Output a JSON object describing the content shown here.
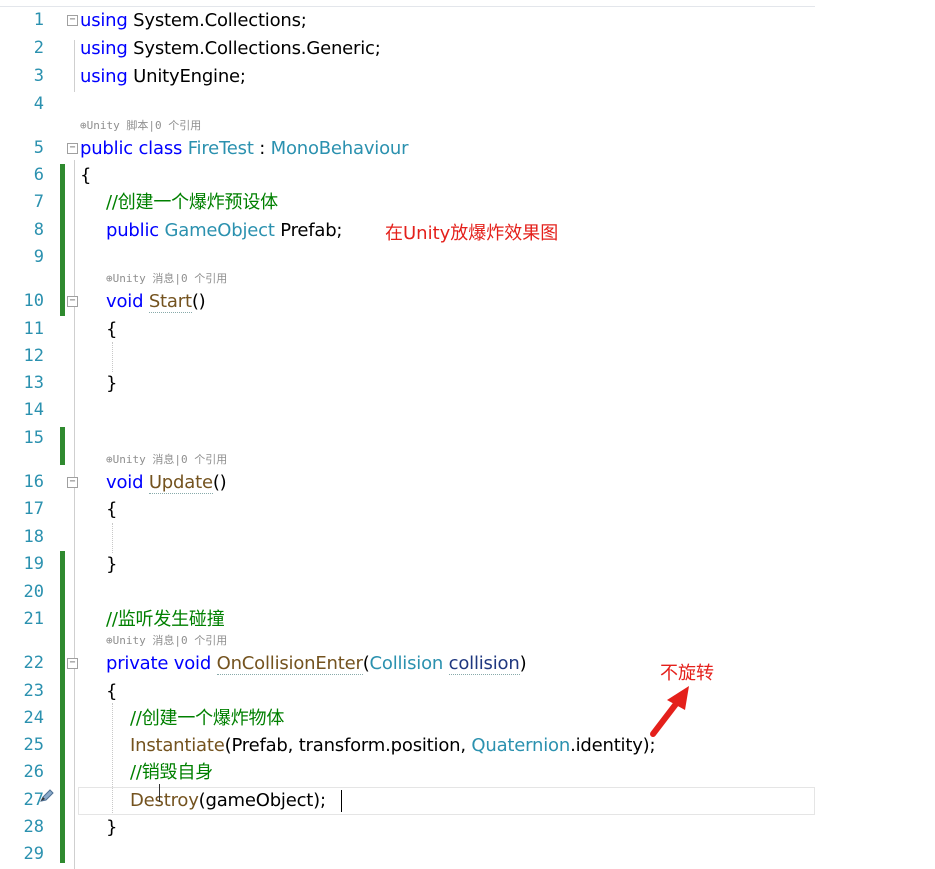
{
  "line_numbers": [
    "1",
    "2",
    "3",
    "4",
    "5",
    "6",
    "7",
    "8",
    "9",
    "10",
    "11",
    "12",
    "13",
    "14",
    "15",
    "16",
    "17",
    "18",
    "19",
    "20",
    "21",
    "22",
    "23",
    "24",
    "25",
    "26",
    "27",
    "28",
    "29"
  ],
  "codelens": {
    "class": "⊕Unity 脚本|0 个引用",
    "start": "⊕Unity 消息|0 个引用",
    "update": "⊕Unity 消息|0 个引用",
    "collision": "⊕Unity 消息|0 个引用"
  },
  "code": {
    "l1_using": "using",
    "l1_ns": " System.Collections;",
    "l2_using": "using",
    "l2_ns": " System.Collections.Generic;",
    "l3_using": "using",
    "l3_ns": " UnityEngine;",
    "l5_public": "public",
    "l5_class": " class ",
    "l5_name": "FireTest",
    "l5_colon": " : ",
    "l5_base": "MonoBehaviour",
    "l6": "{",
    "l7_comment": "//创建一个爆炸预设体",
    "l8_public": "public",
    "l8_type": " GameObject",
    "l8_field": " Prefab;",
    "l10_void": "void",
    "l10_name": "Start",
    "l10_parens": "()",
    "l11": "{",
    "l13": "}",
    "l16_void": "void",
    "l16_name": "Update",
    "l16_parens": "()",
    "l17": "{",
    "l19": "}",
    "l21_comment": "//监听发生碰撞",
    "l22_private": "private",
    "l22_void": " void",
    "l22_name": "OnCollisionEnter",
    "l22_open": "(",
    "l22_type": "Collision",
    "l22_param": "collision",
    "l22_close": ")",
    "l23": "{",
    "l24_comment": "//创建一个爆炸物体",
    "l25_call": "Instantiate",
    "l25_args": "(Prefab, transform.position, ",
    "l25_type": "Quaternion",
    "l25_end": ".identity);",
    "l26_comment": "//销毁自身",
    "l27_call": "Destroy",
    "l27_args": "(gameObject);",
    "l28": "}"
  },
  "annotations": {
    "prefab_note": "在Unity放爆炸效果图",
    "rotation_note": "不旋转"
  },
  "colors": {
    "keyword": "#0000ff",
    "type": "#2b91af",
    "comment": "#008000",
    "method": "#74531f",
    "line_number": "#2b91af",
    "change_bar": "#2f8a2f",
    "annotation": "#e4201b"
  },
  "icons": {
    "edit": "pencil-icon",
    "arrow": "red-arrow-icon",
    "fold": "collapse-icon"
  }
}
